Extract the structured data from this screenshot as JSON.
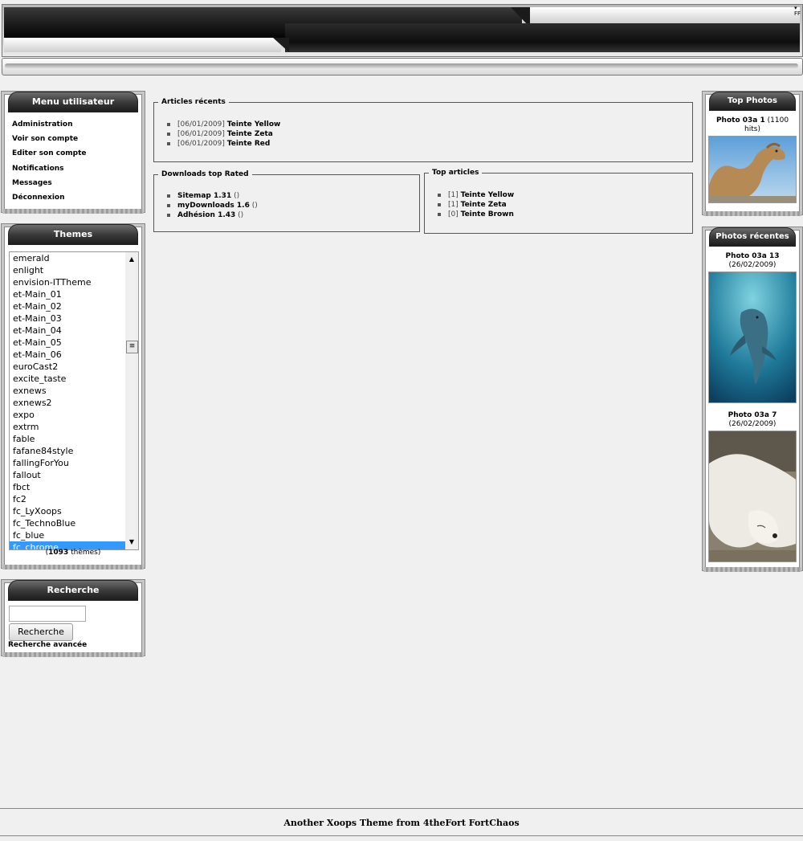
{
  "user_menu": {
    "title": "Menu utilisateur",
    "items": [
      "Administration",
      "Voir son compte",
      "Editer son compte",
      "Notifications",
      "Messages",
      "Déconnexion"
    ]
  },
  "themes": {
    "title": "Themes",
    "items": [
      "emerald",
      "enlight",
      "envision-ITTheme",
      "et-Main_01",
      "et-Main_02",
      "et-Main_03",
      "et-Main_04",
      "et-Main_05",
      "et-Main_06",
      "euroCast2",
      "excite_taste",
      "exnews",
      "exnews2",
      "expo",
      "extrm",
      "fable",
      "fafane84style",
      "fallingForYou",
      "fallout",
      "fbct",
      "fc2",
      "fc_LyXoops",
      "fc_TechnoBlue",
      "fc_blue",
      "fc_chrome"
    ],
    "selected": "fc_chrome",
    "count": "1093",
    "count_suffix": " thèmes)",
    "count_prefix": "("
  },
  "search": {
    "title": "Recherche",
    "input_value": "",
    "button_label": "Recherche",
    "advanced_label": "Recherche avancée"
  },
  "articles_recents": {
    "title": "Articles récents",
    "items": [
      {
        "date": "[06/01/2009]",
        "label": "Teinte Yellow"
      },
      {
        "date": "[06/01/2009]",
        "label": "Teinte Zeta"
      },
      {
        "date": "[06/01/2009]",
        "label": "Teinte Red"
      }
    ]
  },
  "downloads_top": {
    "title": "Downloads top Rated",
    "items": [
      {
        "label": "Sitemap 1.31",
        "extra": " ()"
      },
      {
        "label": "myDownloads 1.6",
        "extra": " ()"
      },
      {
        "label": "Adhésion 1.43",
        "extra": " ()"
      }
    ]
  },
  "top_articles": {
    "title": "Top articles",
    "items": [
      {
        "count": "[1]",
        "label": "Teinte Yellow"
      },
      {
        "count": "[1]",
        "label": "Teinte Zeta"
      },
      {
        "count": "[0]",
        "label": "Teinte Brown"
      }
    ]
  },
  "top_photos": {
    "title": "Top Photos",
    "items": [
      {
        "name": "Photo 03a 1",
        "meta": " (1100 hits)"
      }
    ]
  },
  "recent_photos": {
    "title": "Photos récentes",
    "items": [
      {
        "name": "Photo 03a 13",
        "meta": " (26/02/2009)"
      },
      {
        "name": "Photo 03a 7",
        "meta": " (26/02/2009)"
      }
    ]
  },
  "footer": {
    "text": "Another Xoops Theme from 4theFort FortChaos"
  },
  "colors": {
    "page_bg": "#f0f0f0",
    "block_head": "#3b3b3b",
    "selection": "#3399ff"
  }
}
